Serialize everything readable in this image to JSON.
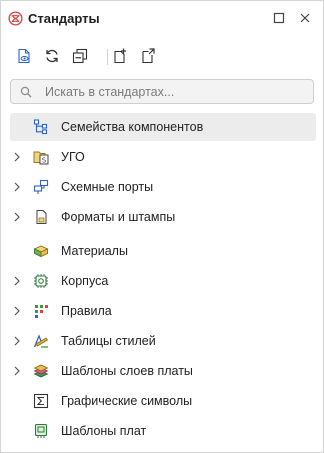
{
  "window": {
    "title": "Стандарты",
    "accent": "#d6453d"
  },
  "search": {
    "placeholder": "Искать в стандартах..."
  },
  "toolbar": {
    "buttons": [
      "view-icon",
      "refresh-icon",
      "collapse-all-icon",
      "add-icon",
      "export-icon"
    ]
  },
  "tree": {
    "items": [
      {
        "label": "Семейства компонентов",
        "icon": "component-families-icon",
        "expandable": false,
        "selected": true
      },
      {
        "label": "УГО",
        "icon": "symbol-library-icon",
        "expandable": true,
        "selected": false
      },
      {
        "label": "Схемные порты",
        "icon": "schematic-ports-icon",
        "expandable": true,
        "selected": false
      },
      {
        "label": "Форматы и штампы",
        "icon": "formats-stamps-icon",
        "expandable": true,
        "selected": false
      },
      {
        "label": "Материалы",
        "icon": "materials-icon",
        "expandable": false,
        "selected": false
      },
      {
        "label": "Корпуса",
        "icon": "packages-icon",
        "expandable": true,
        "selected": false
      },
      {
        "label": "Правила",
        "icon": "rules-icon",
        "expandable": true,
        "selected": false
      },
      {
        "label": "Таблицы стилей",
        "icon": "style-tables-icon",
        "expandable": true,
        "selected": false
      },
      {
        "label": "Шаблоны слоев платы",
        "icon": "layer-templates-icon",
        "expandable": true,
        "selected": false
      },
      {
        "label": "Графические символы",
        "icon": "graphic-symbols-icon",
        "expandable": false,
        "selected": false
      },
      {
        "label": "Шаблоны плат",
        "icon": "board-templates-icon",
        "expandable": false,
        "selected": false
      }
    ]
  }
}
